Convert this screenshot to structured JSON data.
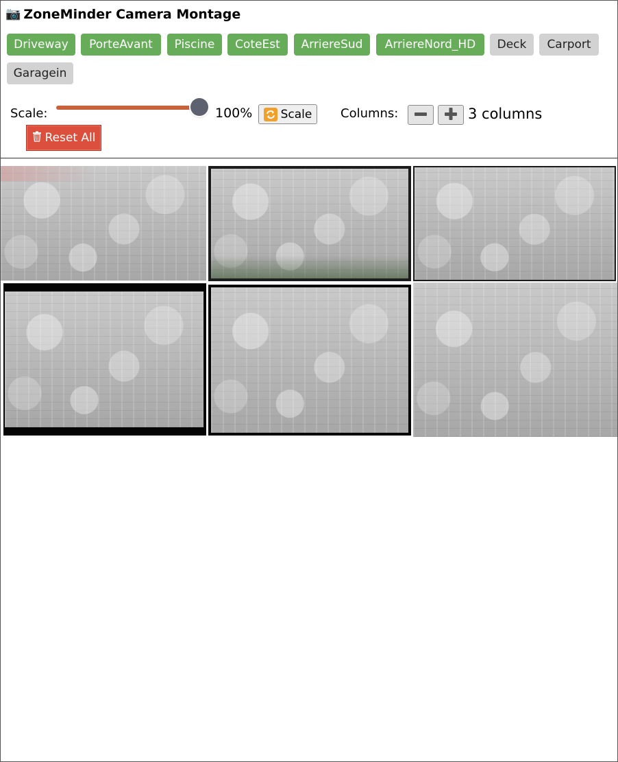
{
  "app": {
    "title": "ZoneMinder Camera Montage",
    "title_icon": "camera-icon"
  },
  "monitors": [
    {
      "label": "Driveway",
      "active": true
    },
    {
      "label": "PorteAvant",
      "active": true
    },
    {
      "label": "Piscine",
      "active": true
    },
    {
      "label": "CoteEst",
      "active": true
    },
    {
      "label": "ArriereSud",
      "active": true
    },
    {
      "label": "ArriereNord_HD",
      "active": true
    },
    {
      "label": "Deck",
      "active": false
    },
    {
      "label": "Carport",
      "active": false
    },
    {
      "label": "Garagein",
      "active": false
    }
  ],
  "controls": {
    "scale_label": "Scale:",
    "scale_percent": 100,
    "scale_value": "100%",
    "scale_button": "Scale",
    "columns_label": "Columns:",
    "columns_value": "3 columns",
    "reset_label": "Reset All"
  },
  "colors": {
    "active_button": "#66ac59",
    "inactive_button": "#d2d2d2",
    "slider": "#c8623c",
    "reset_button": "#dc4f3c"
  },
  "feeds": [
    {
      "monitor": "Driveway",
      "tint": "#c6c2c2"
    },
    {
      "monitor": "PorteAvant",
      "tint": "#9ea29a"
    },
    {
      "monitor": "Piscine",
      "tint": "#cfcfcf"
    },
    {
      "monitor": "CoteEst",
      "tint": "#b3b3b3"
    },
    {
      "monitor": "ArriereSud",
      "tint": "#b8b8b8"
    },
    {
      "monitor": "ArriereNord_HD",
      "tint": "#bdbdbd"
    }
  ]
}
